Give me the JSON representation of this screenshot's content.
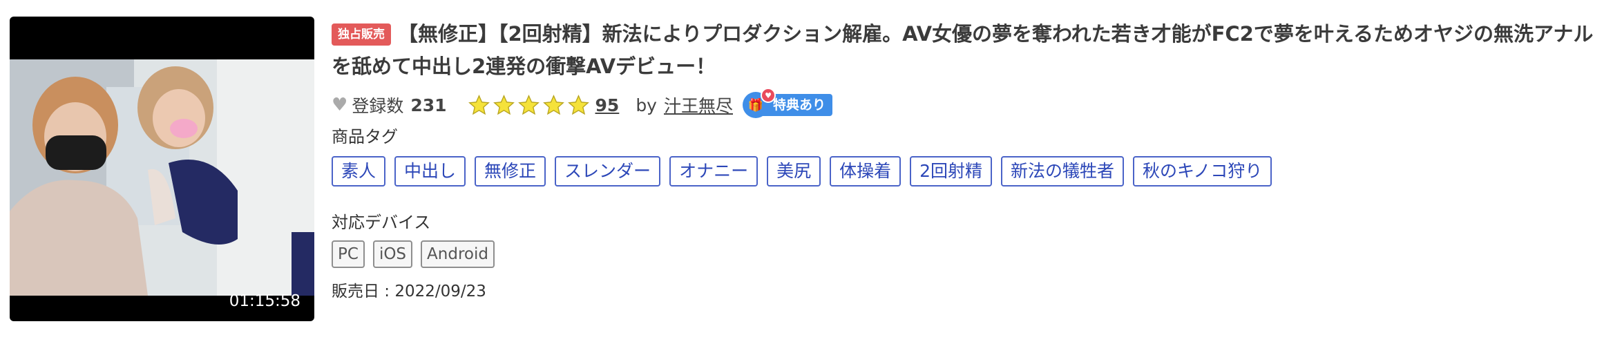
{
  "thumbnail": {
    "duration": "01:15:58"
  },
  "product": {
    "badge": "独占販売",
    "title": "【無修正】【2回射精】新法によりプロダクション解雇。AV女優の夢を奪われた若き才能がFC2で夢を叶えるためオヤジの無洗アナルを舐めて中出し2連発の衝撃AVデビュー！"
  },
  "meta": {
    "favorites_label": "登録数",
    "favorites_count": "231",
    "rating_stars": 5,
    "rating_count": "95",
    "by_label": "by",
    "seller": "汁王無尽",
    "perk_icon": "gift-icon",
    "perk_label": "特典あり"
  },
  "tags_section": {
    "label": "商品タグ",
    "tags": [
      "素人",
      "中出し",
      "無修正",
      "スレンダー",
      "オナニー",
      "美尻",
      "体操着",
      "2回射精",
      "新法の犠牲者",
      "秋のキノコ狩り"
    ]
  },
  "devices_section": {
    "label": "対応デバイス",
    "devices": [
      "PC",
      "iOS",
      "Android"
    ]
  },
  "release": {
    "text": "販売日 : 2022/09/23"
  },
  "colors": {
    "badge_red": "#e35a5a",
    "star_yellow": "#f5e23a",
    "tag_blue": "#4a63c8",
    "perk_blue": "#3f8ee8"
  }
}
